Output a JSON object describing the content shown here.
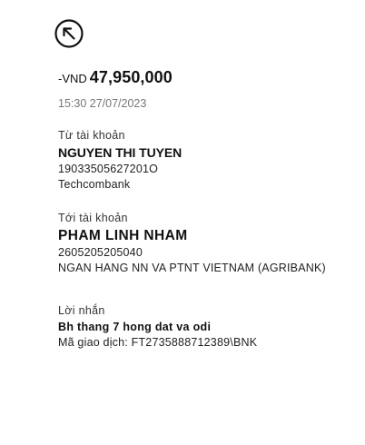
{
  "header": {
    "back_icon": "arrow-up-left-circle-icon"
  },
  "transaction": {
    "currency_prefix": "-VND",
    "amount": "47,950,000",
    "datetime": "15:30 27/07/2023"
  },
  "from_account": {
    "label": "Từ tài khoản",
    "name": "NGUYEN THI TUYEN",
    "number": "19033505627201O",
    "bank": "Techcombank"
  },
  "to_account": {
    "label": "Tới tài khoản",
    "name": "PHAM LINH NHAM",
    "number": "2605205205040",
    "bank": "NGAN HANG NN VA PTNT VIETNAM (AGRIBANK)"
  },
  "note": {
    "label": "Lời nhắn",
    "message": "Bh thang 7 hong dat va odi",
    "reference": "Mã giao dịch: FT2735888712389\\BNK"
  }
}
